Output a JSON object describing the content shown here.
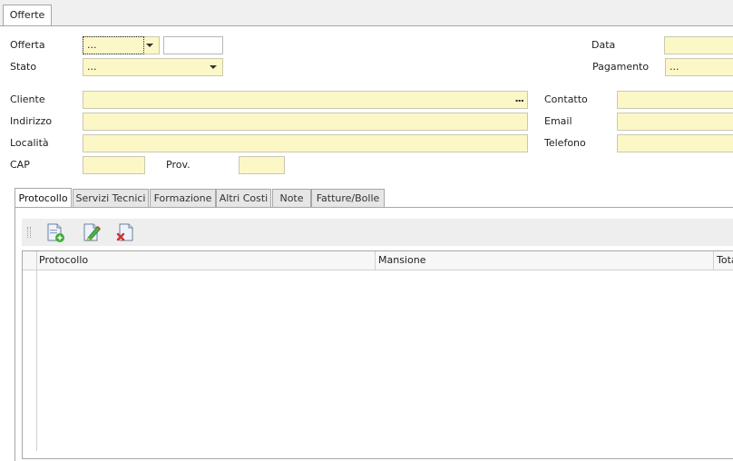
{
  "top_tab": {
    "label": "Offerte"
  },
  "form": {
    "offerta": {
      "label": "Offerta",
      "value": "...",
      "number": ""
    },
    "stato": {
      "label": "Stato",
      "value": "..."
    },
    "data": {
      "label": "Data",
      "value": ""
    },
    "pagamento": {
      "label": "Pagamento",
      "value": "..."
    },
    "cliente": {
      "label": "Cliente",
      "value": "",
      "button": "..."
    },
    "indirizzo": {
      "label": "Indirizzo",
      "value": ""
    },
    "localita": {
      "label": "Località",
      "value": ""
    },
    "cap": {
      "label": "CAP",
      "value": ""
    },
    "prov": {
      "label": "Prov.",
      "value": ""
    },
    "contatto": {
      "label": "Contatto",
      "value": ""
    },
    "email": {
      "label": "Email",
      "value": ""
    },
    "telefono": {
      "label": "Telefono",
      "value": ""
    }
  },
  "tabs": [
    {
      "label": "Protocollo",
      "active": true
    },
    {
      "label": "Servizi Tecnici"
    },
    {
      "label": "Formazione"
    },
    {
      "label": "Altri Costi"
    },
    {
      "label": "Note"
    },
    {
      "label": "Fatture/Bolle"
    }
  ],
  "toolbar": {
    "buttons": [
      {
        "icon": "add-document-icon"
      },
      {
        "icon": "edit-document-icon"
      },
      {
        "icon": "delete-document-icon"
      }
    ]
  },
  "grid": {
    "columns": [
      "Protocollo",
      "Mansione",
      "Tota"
    ],
    "rows": []
  },
  "colors": {
    "field_bg": "#fcf7c7",
    "border": "#a7a7a7"
  }
}
